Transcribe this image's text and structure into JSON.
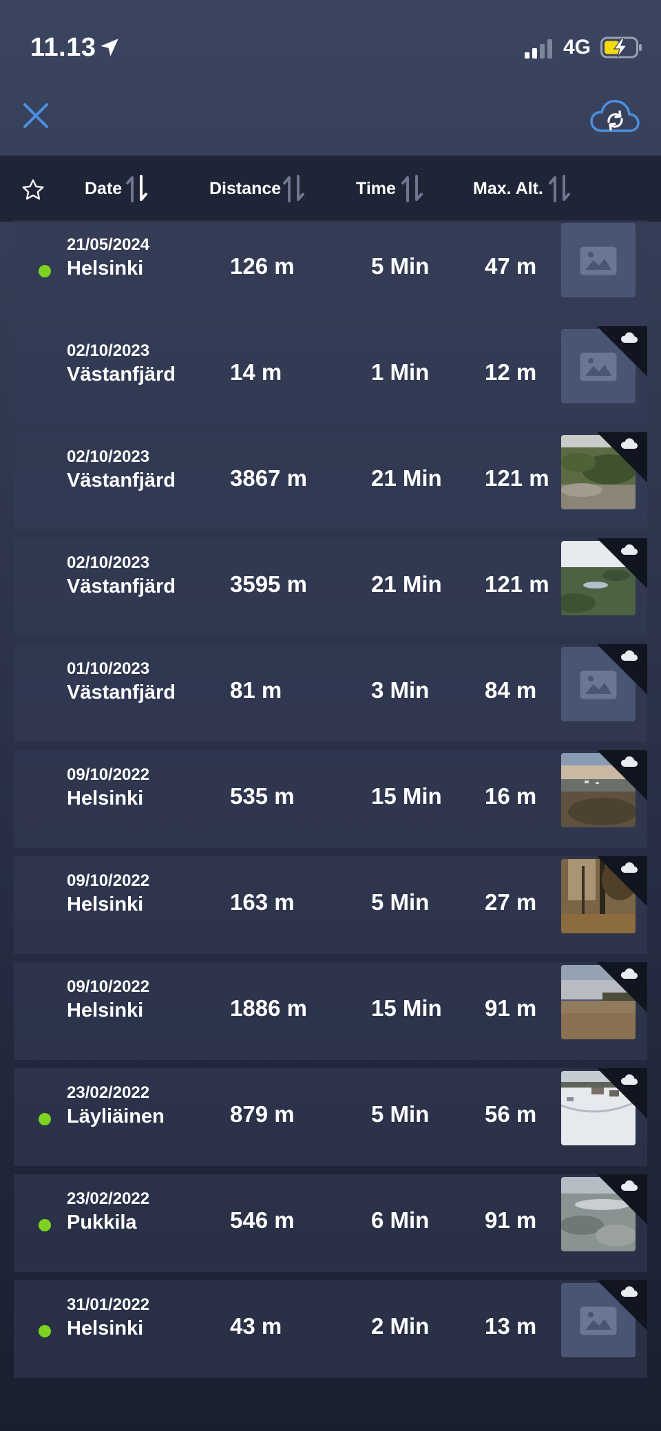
{
  "status": {
    "time": "11.13",
    "network": "4G"
  },
  "header": {
    "date_label": "Date",
    "distance_label": "Distance",
    "time_label": "Time",
    "alt_label": "Max. Alt."
  },
  "flights": [
    {
      "date": "21/05/2024",
      "location": "Helsinki",
      "distance": "126 m",
      "duration": "5 Min",
      "max_alt": "47 m",
      "live": true,
      "thumb": "placeholder",
      "cloud": false
    },
    {
      "date": "02/10/2023",
      "location": "Västanfjärd",
      "distance": "14 m",
      "duration": "1 Min",
      "max_alt": "12 m",
      "live": false,
      "thumb": "placeholder",
      "cloud": true
    },
    {
      "date": "02/10/2023",
      "location": "Västanfjärd",
      "distance": "3867 m",
      "duration": "21 Min",
      "max_alt": "121 m",
      "live": false,
      "thumb": "forest-aerial",
      "cloud": true
    },
    {
      "date": "02/10/2023",
      "location": "Västanfjärd",
      "distance": "3595 m",
      "duration": "21 Min",
      "max_alt": "121 m",
      "live": false,
      "thumb": "lake-aerial",
      "cloud": true
    },
    {
      "date": "01/10/2023",
      "location": "Västanfjärd",
      "distance": "81 m",
      "duration": "3 Min",
      "max_alt": "84 m",
      "live": false,
      "thumb": "placeholder",
      "cloud": true
    },
    {
      "date": "09/10/2022",
      "location": "Helsinki",
      "distance": "535 m",
      "duration": "15 Min",
      "max_alt": "16 m",
      "live": false,
      "thumb": "dusk-town",
      "cloud": true
    },
    {
      "date": "09/10/2022",
      "location": "Helsinki",
      "distance": "163 m",
      "duration": "5 Min",
      "max_alt": "27 m",
      "live": false,
      "thumb": "autumn-trees",
      "cloud": true
    },
    {
      "date": "09/10/2022",
      "location": "Helsinki",
      "distance": "1886 m",
      "duration": "15 Min",
      "max_alt": "91 m",
      "live": false,
      "thumb": "field-sunset",
      "cloud": true
    },
    {
      "date": "23/02/2022",
      "location": "Läyliäinen",
      "distance": "879 m",
      "duration": "5 Min",
      "max_alt": "56 m",
      "live": true,
      "thumb": "snow-village",
      "cloud": true
    },
    {
      "date": "23/02/2022",
      "location": "Pukkila",
      "distance": "546 m",
      "duration": "6 Min",
      "max_alt": "91 m",
      "live": true,
      "thumb": "snow-aerial",
      "cloud": true
    },
    {
      "date": "31/01/2022",
      "location": "Helsinki",
      "distance": "43 m",
      "duration": "2 Min",
      "max_alt": "13 m",
      "live": true,
      "thumb": "placeholder",
      "cloud": true
    }
  ],
  "colors": {
    "accent": "#4a90e2",
    "live_dot": "#7ed321",
    "battery_fill": "#f5d90a"
  },
  "icons": [
    "location-arrow-icon",
    "signal-icon",
    "battery-charging-icon",
    "close-icon",
    "cloud-sync-icon",
    "star-icon",
    "sort-icon",
    "image-placeholder-icon",
    "cloud-icon"
  ]
}
